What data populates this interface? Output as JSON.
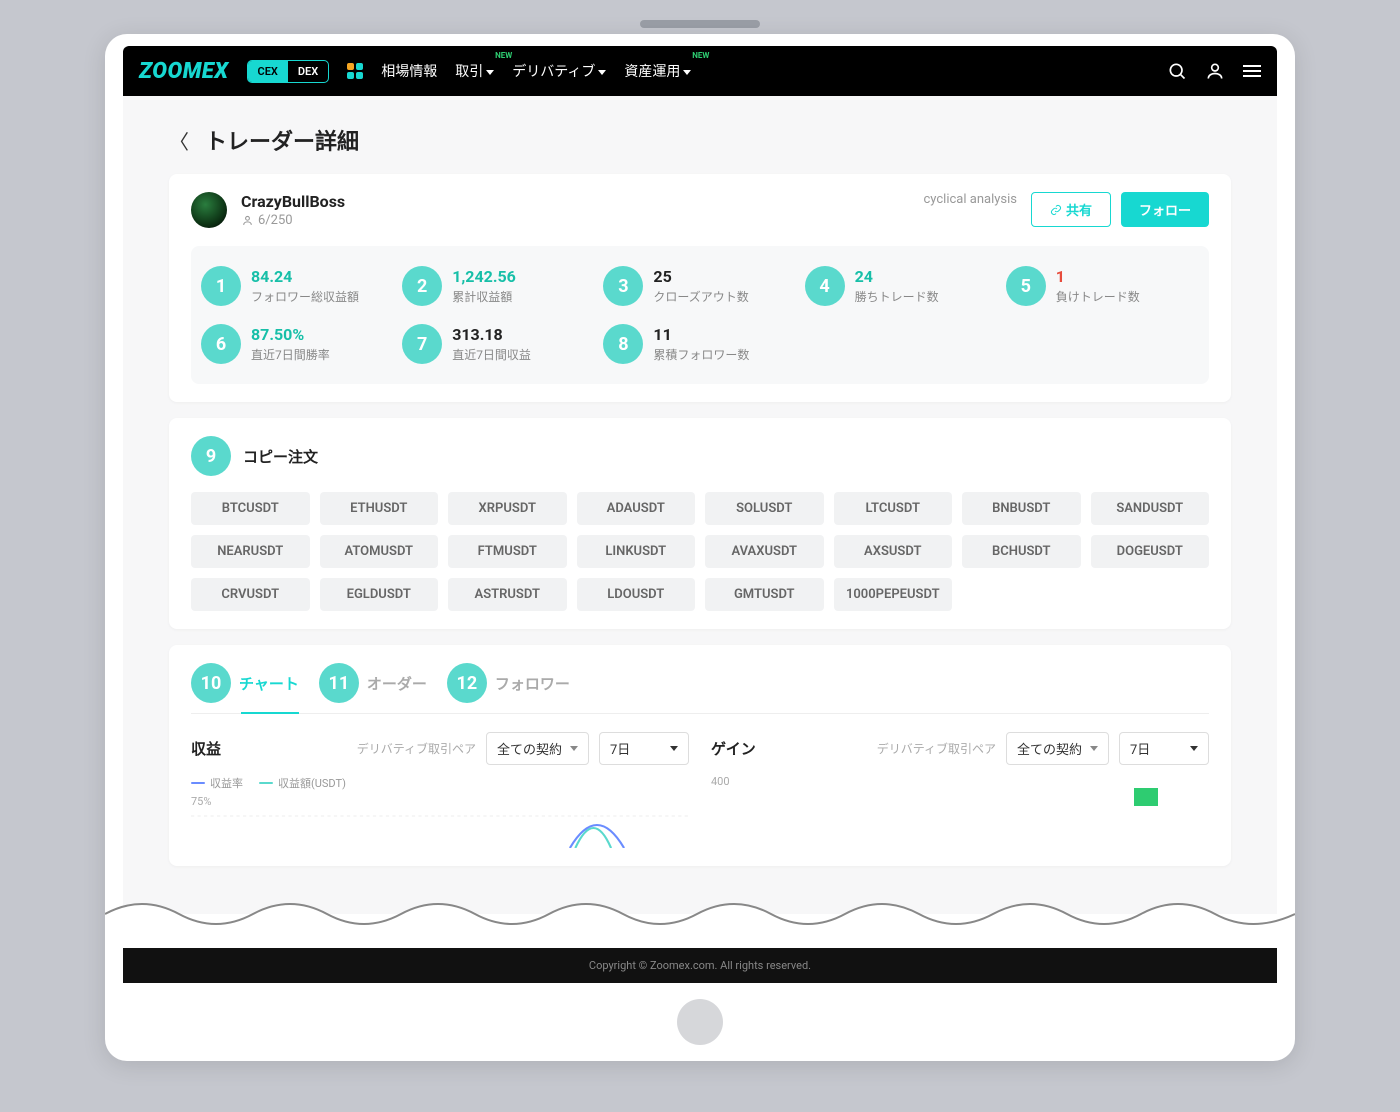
{
  "brand": "ZOOMEX",
  "mode": {
    "cex": "CEX",
    "dex": "DEX"
  },
  "nav": {
    "market": "相場情報",
    "trade": "取引",
    "deriv": "デリバティブ",
    "asset": "資産運用",
    "new_badge": "NEW"
  },
  "page_title": "トレーダー詳細",
  "trader": {
    "name": "CrazyBullBoss",
    "capacity": "6/250",
    "note": "cyclical analysis",
    "share": "共有",
    "follow": "フォロー"
  },
  "stats": [
    {
      "n": "1",
      "val": "84.24",
      "cls": "teal",
      "label": "フォロワー総収益額"
    },
    {
      "n": "2",
      "val": "1,242.56",
      "cls": "teal",
      "label": "累計収益額"
    },
    {
      "n": "3",
      "val": "25",
      "cls": "black",
      "label": "クローズアウト数"
    },
    {
      "n": "4",
      "val": "24",
      "cls": "teal",
      "label": "勝ちトレード数"
    },
    {
      "n": "5",
      "val": "1",
      "cls": "red",
      "label": "負けトレード数"
    },
    {
      "n": "6",
      "val": "87.50%",
      "cls": "teal",
      "label": "直近7日間勝率"
    },
    {
      "n": "7",
      "val": "313.18",
      "cls": "black",
      "label": "直近7日間収益"
    },
    {
      "n": "8",
      "val": "11",
      "cls": "black",
      "label": "累積フォロワー数"
    }
  ],
  "copy_order": {
    "badge": "9",
    "title": "コピー注文",
    "pairs": [
      "BTCUSDT",
      "ETHUSDT",
      "XRPUSDT",
      "ADAUSDT",
      "SOLUSDT",
      "LTCUSDT",
      "BNBUSDT",
      "SANDUSDT",
      "NEARUSDT",
      "ATOMUSDT",
      "FTMUSDT",
      "LINKUSDT",
      "AVAXUSDT",
      "AXSUSDT",
      "BCHUSDT",
      "DOGEUSDT",
      "CRVUSDT",
      "EGLDUSDT",
      "ASTRUSDT",
      "LDOUSDT",
      "GMTUSDT",
      "1000PEPEUSDT"
    ]
  },
  "tabs": [
    {
      "n": "10",
      "label": "チャート",
      "active": true
    },
    {
      "n": "11",
      "label": "オーダー",
      "active": false
    },
    {
      "n": "12",
      "label": "フォロワー",
      "active": false
    }
  ],
  "chart": {
    "panel1_title": "収益",
    "panel2_title": "ゲイン",
    "filter_label": "デリバティブ取引ペア",
    "contract_sel": "全ての契約",
    "period_sel": "7日",
    "legend_rate": "収益率",
    "legend_amount": "収益額(USDT)",
    "ytick1": "75%",
    "ytick2": "400"
  },
  "footer": "Copyright © Zoomex.com. All rights reserved."
}
